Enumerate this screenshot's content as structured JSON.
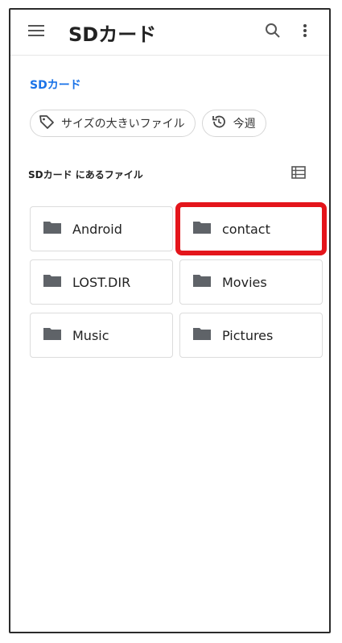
{
  "appbar": {
    "title": "SDカード",
    "icons": [
      "menu-icon",
      "search-icon",
      "more-vert-icon"
    ]
  },
  "breadcrumb": "SDカード",
  "chips": [
    {
      "label": "サイズの大きいファイル",
      "icon": "tag-icon"
    },
    {
      "label": "今週",
      "icon": "history-icon"
    }
  ],
  "section": {
    "label": "SDカード にあるファイル",
    "view_icon": "list-view-icon"
  },
  "folders": [
    {
      "name": "Android"
    },
    {
      "name": "contact",
      "highlighted": true
    },
    {
      "name": "LOST.DIR"
    },
    {
      "name": "Movies"
    },
    {
      "name": "Music"
    },
    {
      "name": "Pictures"
    }
  ],
  "colors": {
    "accent": "#1a73e8",
    "highlight": "#e4151b",
    "folder_icon": "#5f6368"
  }
}
